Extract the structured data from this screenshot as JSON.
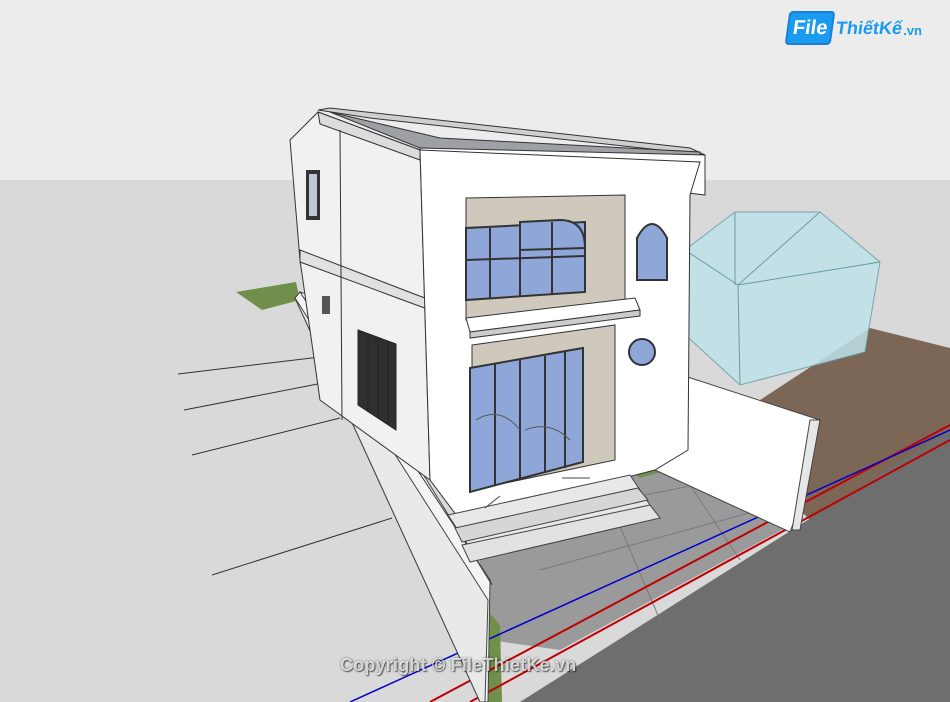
{
  "brand": {
    "logo_box": "File",
    "logo_rest": "ThiếtKế",
    "logo_suffix": ".vn"
  },
  "watermark": "Copyright © FileThietKe.vn",
  "colors": {
    "sky": "#ececec",
    "ground": "#d9d9d9",
    "wall_white": "#ffffff",
    "wood_panel": "#cfc8bd",
    "glass": "#8fa6d8",
    "ghost_house": "#bfe3ea",
    "paving": "#9a9a9a",
    "road": "#6e6e6e",
    "brown_lot": "#7c6656",
    "grass": "#6f8f4a",
    "axis_red": "#c00000",
    "axis_blue": "#0000cc",
    "brand_blue": "#1a9bf0"
  },
  "scene": {
    "icon": "house-3d-model-icon"
  }
}
